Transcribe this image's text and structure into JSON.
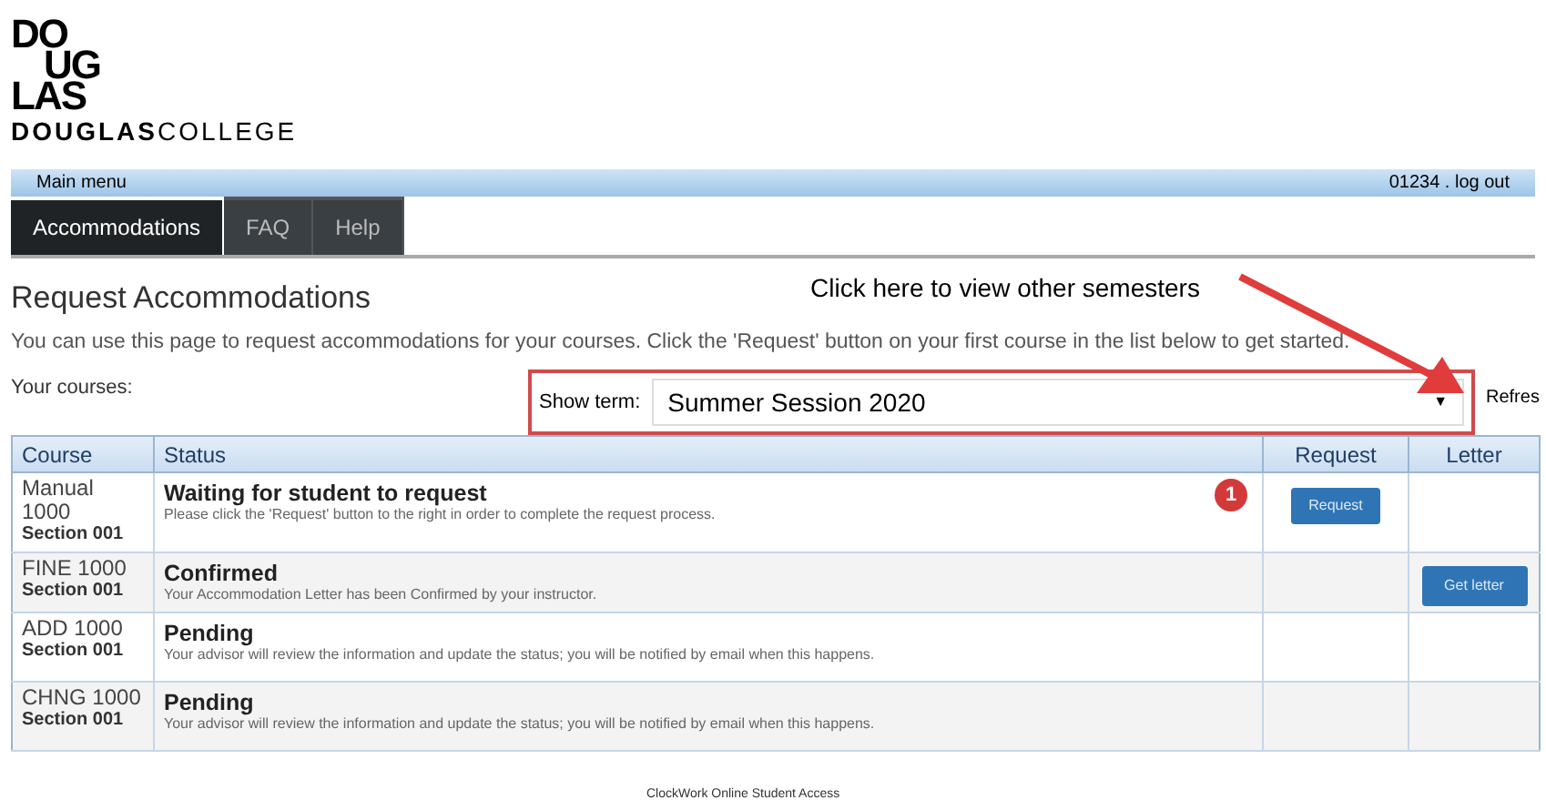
{
  "logo": {
    "lines": [
      "DO",
      "UG",
      "LAS"
    ],
    "wordmark_bold": "DOUGLAS",
    "wordmark": "COLLEGE"
  },
  "menu_bar": {
    "title": "Main menu",
    "user": "01234 . log out"
  },
  "tabs": [
    {
      "label": "Accommodations",
      "selected": true
    },
    {
      "label": "FAQ",
      "selected": false
    },
    {
      "label": "Help",
      "selected": false
    }
  ],
  "heading": "Request Accommodations",
  "annotation": {
    "text": "Click here to view other semesters",
    "badge": "1"
  },
  "intro": "You can use this page to request accommodations for your courses. Click the 'Request' button on your first course in the list below to get started.",
  "courses_label": "Your courses:",
  "term": {
    "label": "Show term:",
    "value": "Summer Session 2020",
    "refresh": "Refres",
    "caret": "▼"
  },
  "table": {
    "columns": [
      "Course",
      "Status",
      "Request",
      "Letter"
    ],
    "rows": [
      {
        "course": "Manual 1000",
        "section": "Section 001",
        "status": "Waiting for student to request",
        "detail": "Please click the 'Request' button to the right in order to complete the request process.",
        "request": "Request"
      },
      {
        "course": "FINE 1000",
        "section": "Section 001",
        "status": "Confirmed",
        "detail": "Your Accommodation Letter has been Confirmed by your instructor.",
        "letter": "Get letter"
      },
      {
        "course": "ADD 1000",
        "section": "Section 001",
        "status": "Pending",
        "detail": "Your advisor will review the information and update the status; you will be notified by email when this happens."
      },
      {
        "course": "CHNG 1000",
        "section": "Section 001",
        "status": "Pending",
        "detail": "Your advisor will review the information and update the status; you will be notified by email when this happens."
      }
    ]
  },
  "footer": "ClockWork Online Student Access"
}
